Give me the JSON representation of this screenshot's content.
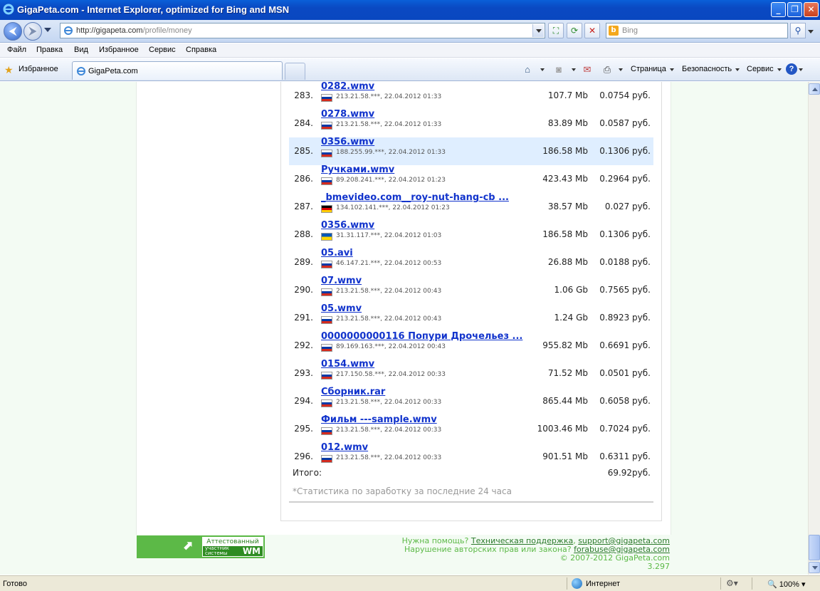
{
  "window": {
    "title": "GigaPeta.com - Internet Explorer, optimized for Bing and MSN"
  },
  "address": {
    "url_host": "http://gigapeta.com",
    "url_path": "/profile/money"
  },
  "search": {
    "placeholder": "Bing"
  },
  "menu": [
    "Файл",
    "Правка",
    "Вид",
    "Избранное",
    "Сервис",
    "Справка"
  ],
  "favorites": {
    "label": "Избранное"
  },
  "tab": {
    "title": "GigaPeta.com"
  },
  "toolbar": {
    "page": "Страница",
    "safety": "Безопасность",
    "tools": "Сервис",
    "help": "?"
  },
  "rows": [
    {
      "n": "283.",
      "file": "0282.wmv",
      "meta": "213.21.58.***, 22.04.2012 01:33",
      "flag": "ru",
      "size": "107.7 Mb",
      "price": "0.0754 руб."
    },
    {
      "n": "284.",
      "file": "0278.wmv",
      "meta": "213.21.58.***, 22.04.2012 01:33",
      "flag": "ru",
      "size": "83.89 Mb",
      "price": "0.0587 руб."
    },
    {
      "n": "285.",
      "file": "0356.wmv",
      "meta": "188.255.99.***, 22.04.2012 01:33",
      "flag": "ru",
      "size": "186.58 Mb",
      "price": "0.1306 руб.",
      "hl": true
    },
    {
      "n": "286.",
      "file": "Ручками.wmv",
      "meta": "89.208.241.***, 22.04.2012 01:23",
      "flag": "ru",
      "size": "423.43 Mb",
      "price": "0.2964 руб."
    },
    {
      "n": "287.",
      "file": "_bmevideo.com__roy-nut-hang-cb ...",
      "meta": "134.102.141.***, 22.04.2012 01:23",
      "flag": "de",
      "size": "38.57 Mb",
      "price": "0.027 руб."
    },
    {
      "n": "288.",
      "file": "0356.wmv",
      "meta": "31.31.117.***, 22.04.2012 01:03",
      "flag": "ua",
      "size": "186.58 Mb",
      "price": "0.1306 руб."
    },
    {
      "n": "289.",
      "file": "05.avi",
      "meta": "46.147.21.***, 22.04.2012 00:53",
      "flag": "ru",
      "size": "26.88 Mb",
      "price": "0.0188 руб."
    },
    {
      "n": "290.",
      "file": "07.wmv",
      "meta": "213.21.58.***, 22.04.2012 00:43",
      "flag": "ru",
      "size": "1.06 Gb",
      "price": "0.7565 руб."
    },
    {
      "n": "291.",
      "file": "05.wmv",
      "meta": "213.21.58.***, 22.04.2012 00:43",
      "flag": "ru",
      "size": "1.24 Gb",
      "price": "0.8923 руб."
    },
    {
      "n": "292.",
      "file": "0000000000116 Попури Дрочельез ...",
      "meta": "89.169.163.***, 22.04.2012 00:43",
      "flag": "ru",
      "size": "955.82 Mb",
      "price": "0.6691 руб."
    },
    {
      "n": "293.",
      "file": "0154.wmv",
      "meta": "217.150.58.***, 22.04.2012 00:33",
      "flag": "ru",
      "size": "71.52 Mb",
      "price": "0.0501 руб."
    },
    {
      "n": "294.",
      "file": "Сборник.rar",
      "meta": "213.21.58.***, 22.04.2012 00:33",
      "flag": "ru",
      "size": "865.44 Mb",
      "price": "0.6058 руб."
    },
    {
      "n": "295.",
      "file": "Фильм ---sample.wmv",
      "meta": "213.21.58.***, 22.04.2012 00:33",
      "flag": "ru",
      "size": "1003.46 Mb",
      "price": "0.7024 руб."
    },
    {
      "n": "296.",
      "file": "012.wmv",
      "meta": "213.21.58.***, 22.04.2012 00:33",
      "flag": "ru",
      "size": "901.51 Mb",
      "price": "0.6311 руб."
    }
  ],
  "summary": {
    "label": "Итого:",
    "value": "69.92руб.",
    "note": "*Статистика по заработку за последние 24 часа"
  },
  "badge": {
    "top": "Аттестованный",
    "bottom1": "участник",
    "bottom2": "системы",
    "wm": "WM"
  },
  "footer": {
    "help_prefix": "Нужна помощь?",
    "support_link": "Техническая поддержка",
    "support_email": "support@gigapeta.com",
    "abuse_prefix": "Нарушение авторских прав или закона?",
    "abuse_email": "forabuse@gigapeta.com",
    "copyright": "© 2007-2012 GigaPeta.com",
    "version": "3.297"
  },
  "status": {
    "ready": "Готово",
    "zone": "Интернет",
    "zoom": "100%"
  }
}
